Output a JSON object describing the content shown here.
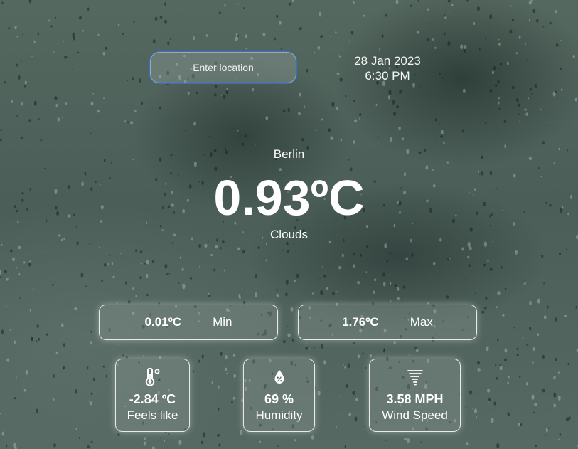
{
  "search": {
    "placeholder": "Enter location"
  },
  "datetime": {
    "date": "28 Jan 2023",
    "time": "6:30 PM"
  },
  "weather": {
    "city": "Berlin",
    "temperature": "0.93ºC",
    "condition": "Clouds"
  },
  "min": {
    "value": "0.01ºC",
    "label": "Min"
  },
  "max": {
    "value": "1.76ºC",
    "label": "Max"
  },
  "feels_like": {
    "value": "-2.84 ºC",
    "label": "Feels like",
    "icon": "thermometer-icon"
  },
  "humidity": {
    "value": "69 %",
    "label": "Humidity",
    "icon": "humidity-drop-icon"
  },
  "wind": {
    "value": "3.58 MPH",
    "label": "Wind Speed",
    "icon": "tornado-icon"
  }
}
